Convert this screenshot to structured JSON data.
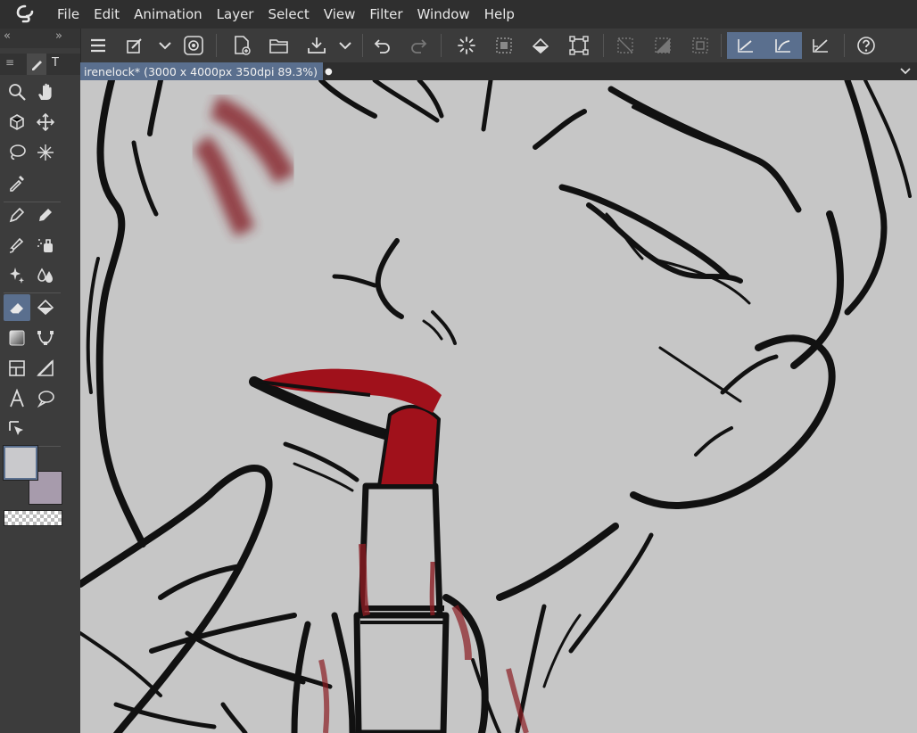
{
  "menu": [
    "File",
    "Edit",
    "Animation",
    "Layer",
    "Select",
    "View",
    "Filter",
    "Window",
    "Help"
  ],
  "document": {
    "tab_title": "irenelock* (3000 x 4000px 350dpi 89.3%)",
    "modified_dot": "●"
  },
  "toolpanel": {
    "tab_label": "T"
  },
  "tools": [
    {
      "name": "zoom-tool-icon"
    },
    {
      "name": "move-hand-icon"
    },
    {
      "name": "3d-object-icon"
    },
    {
      "name": "move-layer-icon"
    },
    {
      "name": "lasso-icon"
    },
    {
      "name": "auto-select-wand-icon"
    },
    {
      "name": "eyedropper-icon"
    },
    {
      "name": "pen-icon"
    },
    {
      "name": "pencil-icon"
    },
    {
      "name": "brush-icon"
    },
    {
      "name": "airbrush-icon"
    },
    {
      "name": "decoration-icon"
    },
    {
      "name": "blend-icon"
    },
    {
      "name": "eraser-icon"
    },
    {
      "name": "fill-icon"
    },
    {
      "name": "gradient-icon"
    },
    {
      "name": "figure-icon"
    },
    {
      "name": "frame-border-icon"
    },
    {
      "name": "ruler-icon"
    },
    {
      "name": "text-icon"
    },
    {
      "name": "balloon-icon"
    },
    {
      "name": "operation-icon"
    }
  ],
  "colors": {
    "main": "#c9c9cc",
    "sub": "#a79bac",
    "accent": "#5a6f8e",
    "lipstick": "#a0111b",
    "canvas": "#c6c6c6"
  }
}
